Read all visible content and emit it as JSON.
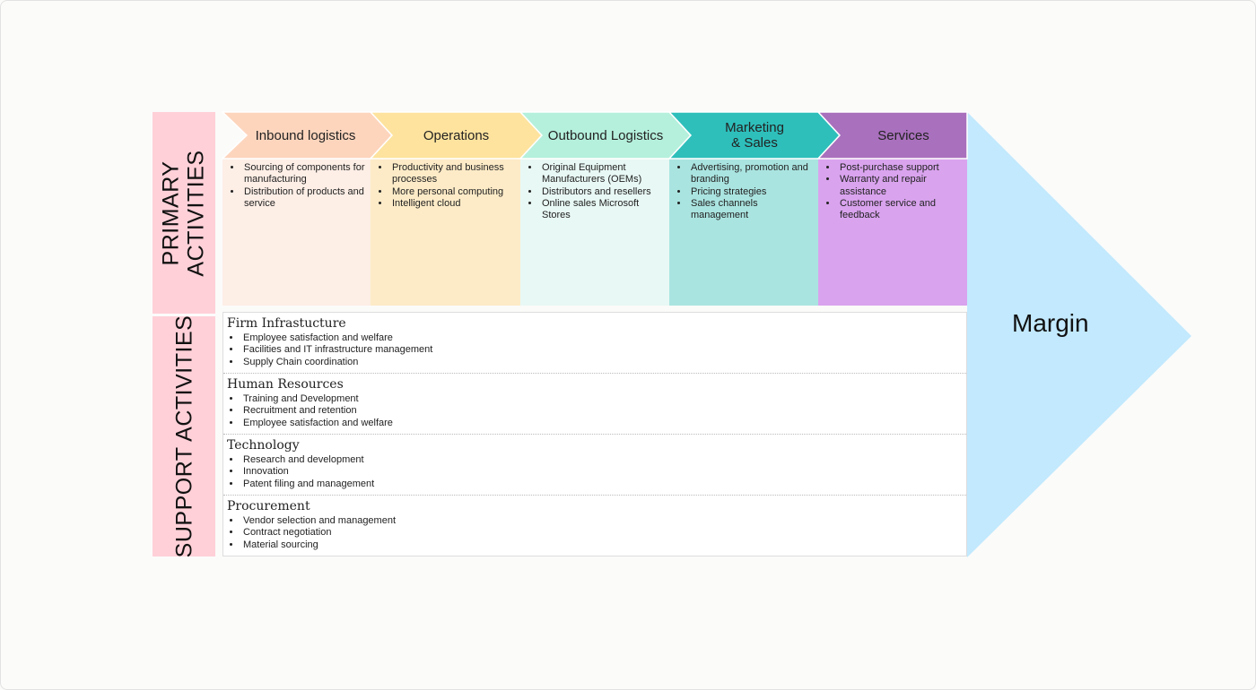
{
  "side_labels": {
    "primary": "PRIMARY\nACTIVITIES",
    "support": "SUPPORT ACTIVITIES"
  },
  "primary": [
    {
      "title": "Inbound logistics",
      "header_color": "#fdd5bd",
      "body_color": "#fdeee6",
      "items": [
        "Sourcing of components for manufacturing",
        "Distribution of products and service"
      ]
    },
    {
      "title": "Operations",
      "header_color": "#fde39e",
      "body_color": "#fdebc7",
      "items": [
        "Productivity and business processes",
        "More personal computing",
        "Intelligent cloud"
      ]
    },
    {
      "title": "Outbound Logistics",
      "header_color": "#b5f0dc",
      "body_color": "#e8f8f4",
      "items": [
        " Original Equipment Manufacturers (OEMs)",
        "Distributors and resellers",
        "Online sales Microsoft Stores"
      ]
    },
    {
      "title": "Marketing\n& Sales",
      "header_color": "#2ebfbb",
      "body_color": "#aae4e0",
      "items": [
        "Advertising, promotion and branding",
        "Pricing strategies",
        "Sales channels management"
      ]
    },
    {
      "title": "Services",
      "header_color": "#a970bd",
      "body_color": "#d9a3ee",
      "items": [
        "Post-purchase support",
        "Warranty and repair assistance",
        "Customer service and feedback"
      ]
    }
  ],
  "support": [
    {
      "title": "Firm Infrastucture",
      "items": [
        "Employee satisfaction and welfare",
        "Facilities and IT infrastructure management",
        "Supply Chain coordination"
      ]
    },
    {
      "title": "Human Resources",
      "items": [
        "Training and Development",
        "Recruitment and retention",
        "Employee satisfaction and welfare"
      ]
    },
    {
      "title": "Technology",
      "items": [
        "Research and development",
        "Innovation",
        "Patent filing and management"
      ]
    },
    {
      "title": "Procurement",
      "items": [
        "Vendor selection and management",
        "Contract negotiation",
        "Material sourcing"
      ]
    }
  ],
  "margin": {
    "label": "Margin",
    "color": "#c2e9fd"
  }
}
